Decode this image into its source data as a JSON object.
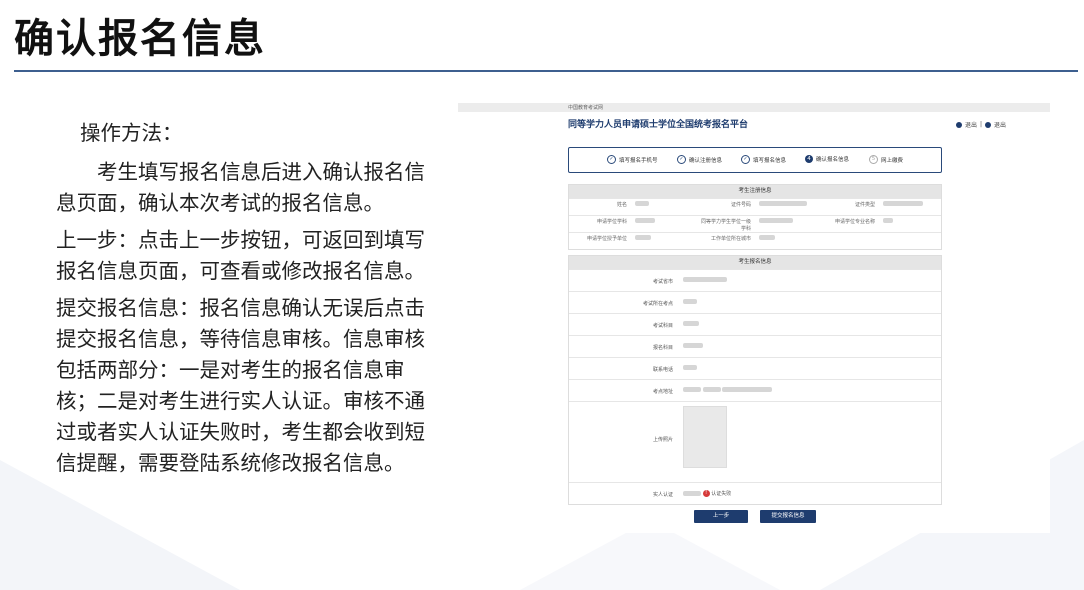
{
  "slide": {
    "title": "确认报名信息"
  },
  "instructions": {
    "method_heading": "操作方法：",
    "p1": "考生填写报名信息后进入确认报名信息页面，确认本次考试的报名信息。",
    "p2": "上一步：点击上一步按钮，可返回到填写报名信息页面，可查看或修改报名信息。",
    "p3": "提交报名信息：报名信息确认无误后点击提交报名信息，等待信息审核。信息审核包括两部分：一是对考生的报名信息审核；二是对考生进行实人认证。审核不通过或者实人认证失败时，考生都会收到短信提醒，需要登陆系统修改报名信息。"
  },
  "embedded": {
    "breadcrumb": "中国教育考试网",
    "platform_title": "同等学力人员申请硕士学位全国统考报名平台",
    "user_links": [
      "退出",
      "退出"
    ],
    "steps": [
      {
        "label": "填写报名手机号",
        "state": "done"
      },
      {
        "label": "确认注册信息",
        "state": "done"
      },
      {
        "label": "填写报名信息",
        "state": "done"
      },
      {
        "label": "确认报名信息",
        "state": "current",
        "num": "4"
      },
      {
        "label": "网上缴费",
        "state": "pending",
        "num": "5"
      }
    ],
    "section1_title": "考生注册信息",
    "section1_rows": [
      [
        "姓名",
        "",
        "证件号码",
        "",
        "证件类型",
        ""
      ],
      [
        "申请学位学科",
        "",
        "同等学力学生学位一级学科",
        "",
        "申请学位专业名称",
        ""
      ],
      [
        "申请学位授予单位",
        "",
        "工作单位所在城市",
        "",
        "",
        ""
      ]
    ],
    "section2_title": "考生报名信息",
    "section2_fields": [
      "考试省市",
      "考试所在考点",
      "考试科目",
      "报名科目",
      "联系电话",
      "考点地址",
      "上传照片",
      "实人认证"
    ],
    "verify_text": "认证失败",
    "btn_prev": "上一步",
    "btn_submit": "提交报名信息"
  }
}
